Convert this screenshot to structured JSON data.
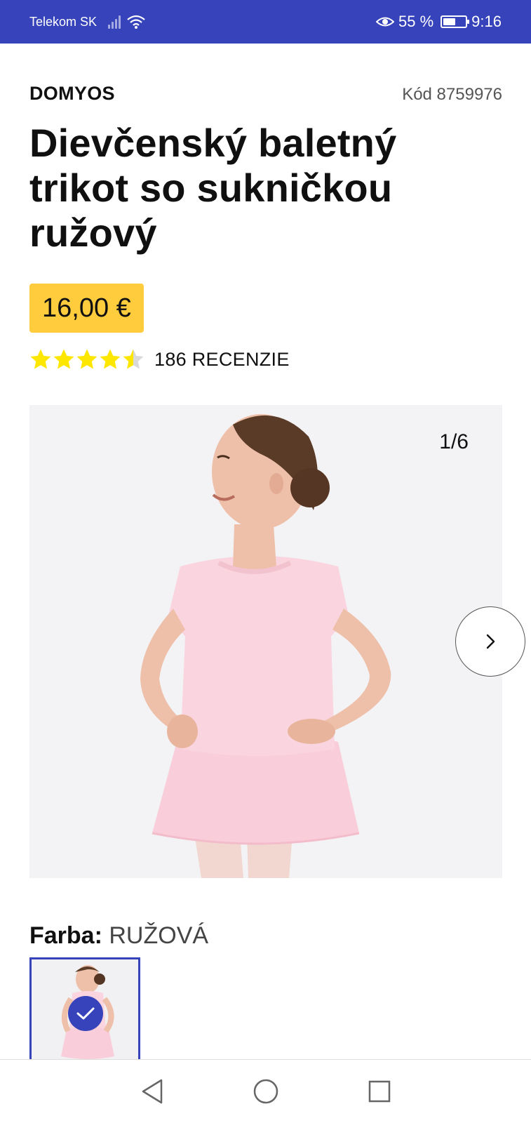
{
  "status_bar": {
    "carrier": "Telekom SK",
    "battery": "55 %",
    "battery_level": 0.55,
    "time": "9:16"
  },
  "product": {
    "brand": "DOMYOS",
    "code": "Kód 8759976",
    "title": "Dievčenský baletný trikot so sukničkou ružový",
    "price": "16,00 €",
    "rating": 4.5,
    "rating_max": 5,
    "reviews": "186 RECENZIE"
  },
  "gallery": {
    "counter": "1/6",
    "background": "#f3f2f4"
  },
  "color": {
    "label": "Farba:",
    "value": "RUŽOVÁ"
  },
  "theme": {
    "primary": "#3643ba",
    "price_bg": "#ffcc3d",
    "star": "#fde600"
  },
  "icons": {
    "next": "chevron-right-icon",
    "selected": "check-icon",
    "nav": [
      "back-icon",
      "home-icon",
      "recents-icon"
    ]
  }
}
